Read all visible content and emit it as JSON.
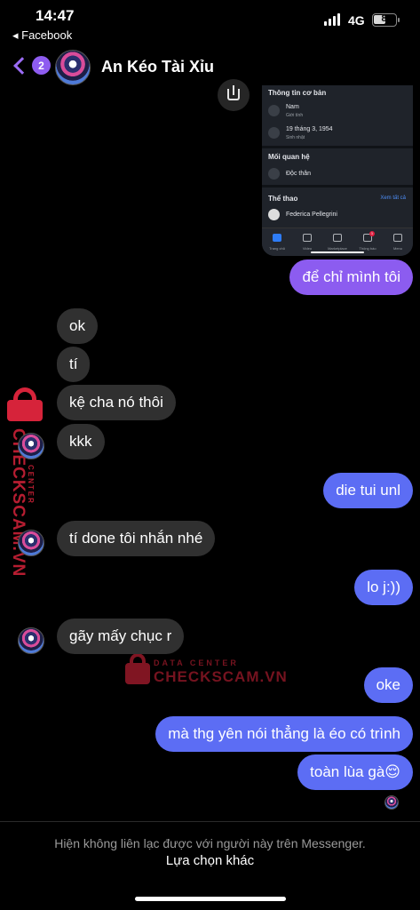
{
  "status_bar": {
    "time": "14:47",
    "back_app": "◂ Facebook",
    "network": "4G",
    "battery": "8"
  },
  "header": {
    "back_count": "2",
    "contact_name": "An Kéo Tài Xỉu",
    "accent_color": "#8e5cf0"
  },
  "shared_screenshot": {
    "basic_info_title": "Thông tin cơ bản",
    "gender_value": "Nam",
    "gender_label": "Giới tính",
    "birthday_value": "19 tháng 3, 1954",
    "birthday_label": "Sinh nhật",
    "relationship_title": "Mối quan hệ",
    "relationship_value": "Độc thân",
    "sports_title": "Thể thao",
    "see_all": "Xem tất cả",
    "athlete": "Federica Pellegrini",
    "tabs": [
      "Trang chủ",
      "Video",
      "Marketplace",
      "Thông báo",
      "Menu"
    ],
    "notification_count": "3"
  },
  "messages": [
    {
      "side": "out",
      "text": "để chỉ mình tôi"
    },
    {
      "side": "in",
      "text": "ok"
    },
    {
      "side": "in",
      "text": "tí"
    },
    {
      "side": "in",
      "text": "kệ cha nó thôi"
    },
    {
      "side": "in",
      "text": "kkk"
    },
    {
      "side": "out",
      "text": "die tui unl"
    },
    {
      "side": "in",
      "text": "tí done tôi nhắn nhé"
    },
    {
      "side": "out",
      "text": "lo j:))"
    },
    {
      "side": "in",
      "text": "gãy mấy chục r"
    },
    {
      "side": "out",
      "text": "oke"
    },
    {
      "side": "out",
      "text": "mà thg yên nói thẳng là éo có trình"
    },
    {
      "side": "out",
      "text": "toàn lùa gà😌"
    }
  ],
  "watermark": {
    "vertical_text": "CHECKSCAM.VN",
    "vertical_sub": "DATA CENTER",
    "center_text": "CHECKSCAM.VN",
    "center_sub": "DATA CENTER"
  },
  "footer": {
    "message": "Hiện không liên lạc được với người này trên Messenger.",
    "action": "Lựa chọn khác"
  },
  "colors": {
    "outgoing_bubble": "#5c6df4",
    "outgoing_bubble_first": "#8c5cf0",
    "incoming_bubble": "#303030",
    "watermark": "#d6233a"
  }
}
